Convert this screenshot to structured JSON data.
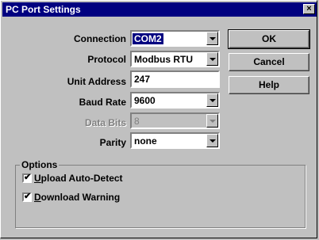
{
  "window": {
    "title": "PC Port Settings",
    "close_symbol": "×"
  },
  "form": {
    "connection": {
      "label": "Connection",
      "value": "COM2"
    },
    "protocol": {
      "label": "Protocol",
      "value": "Modbus RTU"
    },
    "unit_address": {
      "label": "Unit Address",
      "value": "247"
    },
    "baud_rate": {
      "label": "Baud Rate",
      "value": "9600"
    },
    "data_bits": {
      "label": "Data Bits",
      "value": "8"
    },
    "parity": {
      "label": "Parity",
      "value": "none"
    }
  },
  "buttons": {
    "ok": "OK",
    "cancel": "Cancel",
    "help": "Help"
  },
  "options": {
    "title": "Options",
    "upload_auto_detect": {
      "mnemonic": "U",
      "rest": "pload Auto-Detect",
      "checked": true
    },
    "download_warning": {
      "mnemonic": "D",
      "rest": "ownload Warning",
      "checked": true
    }
  },
  "icons": {
    "dropdown": "chevron-down-icon",
    "check": "checkmark-icon"
  }
}
